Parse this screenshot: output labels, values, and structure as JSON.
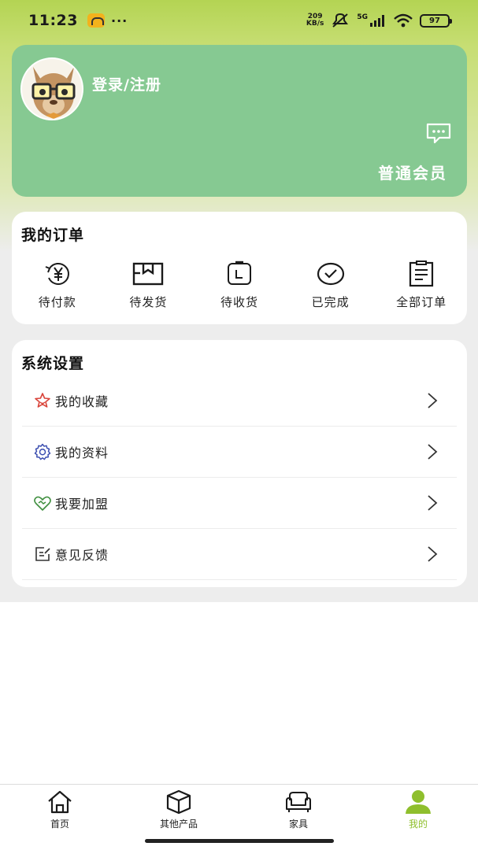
{
  "status_bar": {
    "time": "11:23",
    "dots": "···",
    "net_speed_value": "209",
    "net_speed_unit": "KB/s",
    "signal_label": "5G",
    "battery": "97"
  },
  "profile": {
    "login_label": "登录/注册",
    "member_level": "普通会员"
  },
  "orders": {
    "title": "我的订单",
    "items": [
      {
        "label": "待付款",
        "icon": "yen-payment-icon"
      },
      {
        "label": "待发货",
        "icon": "package-box-icon"
      },
      {
        "label": "待收货",
        "icon": "delivery-receive-icon"
      },
      {
        "label": "已完成",
        "icon": "check-circle-icon"
      },
      {
        "label": "全部订单",
        "icon": "order-list-icon"
      }
    ]
  },
  "settings": {
    "title": "系统设置",
    "items": [
      {
        "label": "我的收藏",
        "icon": "star-icon"
      },
      {
        "label": "我的资料",
        "icon": "gear-icon"
      },
      {
        "label": "我要加盟",
        "icon": "handshake-heart-icon"
      },
      {
        "label": "意见反馈",
        "icon": "feedback-edit-icon"
      }
    ]
  },
  "bottom_nav": {
    "items": [
      {
        "label": "首页",
        "icon": "home-icon"
      },
      {
        "label": "其他产品",
        "icon": "cube-icon"
      },
      {
        "label": "家具",
        "icon": "sofa-icon"
      },
      {
        "label": "我的",
        "icon": "user-icon"
      }
    ],
    "active_index": 3
  },
  "colors": {
    "header_green": "#b4d453",
    "profile_card": "#86c992",
    "active_nav": "#8fbf2d"
  }
}
